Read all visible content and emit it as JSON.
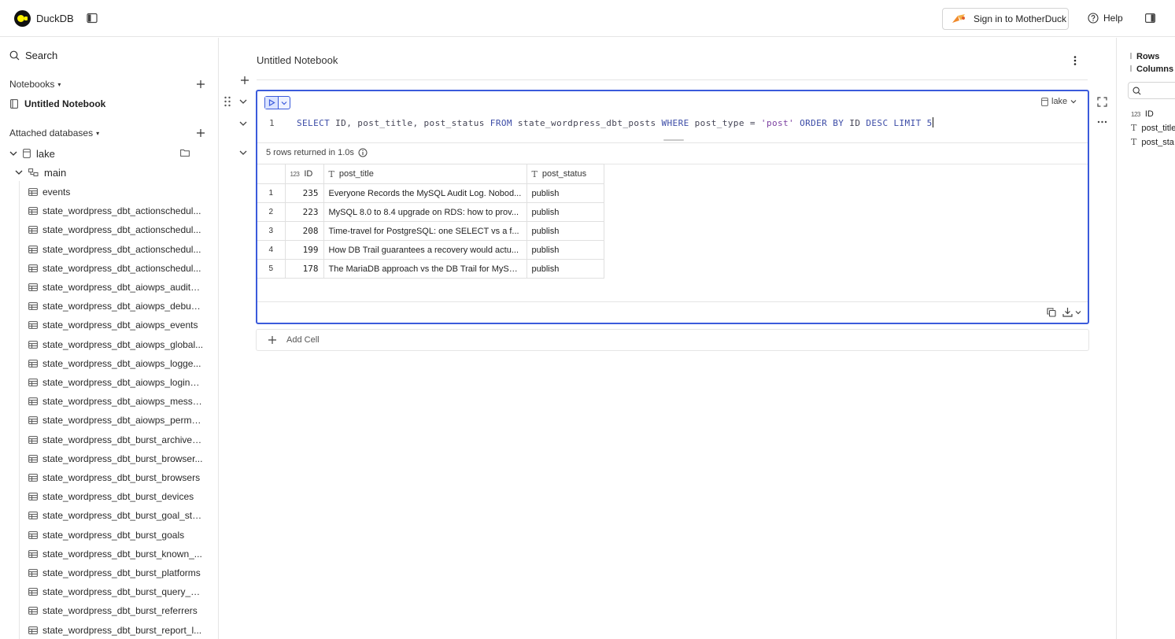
{
  "app": {
    "title": "DuckDB"
  },
  "header": {
    "signin_label": "Sign in to MotherDuck",
    "help_label": "Help"
  },
  "sidebar": {
    "search_label": "Search",
    "notebooks_label": "Notebooks",
    "notebooks": [
      "Untitled Notebook"
    ],
    "attached_label": "Attached databases",
    "database": "lake",
    "schema": "main",
    "tables": [
      "events",
      "state_wordpress_dbt_actionschedul...",
      "state_wordpress_dbt_actionschedul...",
      "state_wordpress_dbt_actionschedul...",
      "state_wordpress_dbt_actionschedul...",
      "state_wordpress_dbt_aiowps_audit_l...",
      "state_wordpress_dbt_aiowps_debug...",
      "state_wordpress_dbt_aiowps_events",
      "state_wordpress_dbt_aiowps_global...",
      "state_wordpress_dbt_aiowps_logge...",
      "state_wordpress_dbt_aiowps_login_l...",
      "state_wordpress_dbt_aiowps_messa...",
      "state_wordpress_dbt_aiowps_perma...",
      "state_wordpress_dbt_burst_archived...",
      "state_wordpress_dbt_burst_browser...",
      "state_wordpress_dbt_burst_browsers",
      "state_wordpress_dbt_burst_devices",
      "state_wordpress_dbt_burst_goal_sta...",
      "state_wordpress_dbt_burst_goals",
      "state_wordpress_dbt_burst_known_...",
      "state_wordpress_dbt_burst_platforms",
      "state_wordpress_dbt_burst_query_st...",
      "state_wordpress_dbt_burst_referrers",
      "state_wordpress_dbt_burst_report_l..."
    ]
  },
  "notebook": {
    "title": "Untitled Notebook",
    "cell": {
      "database": "lake",
      "line_number": "1",
      "query": {
        "t1": "SELECT",
        "t2": " ID, post_title, post_status ",
        "t3": "FROM",
        "t4": " state_wordpress_dbt_posts ",
        "t5": "WHERE",
        "t6": " post_type = ",
        "t7": "'post'",
        "t8": " ",
        "t9": "ORDER BY",
        "t10": " ID ",
        "t11": "DESC",
        "t12": " ",
        "t13": "LIMIT",
        "t14": " 5"
      },
      "result_info": "5 rows returned in 1.0s",
      "columns": [
        {
          "name": "ID",
          "type": "123"
        },
        {
          "name": "post_title",
          "type": "T"
        },
        {
          "name": "post_status",
          "type": "T"
        }
      ],
      "rows": [
        {
          "n": "1",
          "id": "235",
          "title": "Everyone Records the MySQL Audit Log. Nobod...",
          "status": "publish"
        },
        {
          "n": "2",
          "id": "223",
          "title": "MySQL 8.0 to 8.4 upgrade on RDS: how to prov...",
          "status": "publish"
        },
        {
          "n": "3",
          "id": "208",
          "title": "Time-travel for PostgreSQL: one SELECT vs a f...",
          "status": "publish"
        },
        {
          "n": "4",
          "id": "199",
          "title": "How DB Trail guarantees a recovery would actu...",
          "status": "publish"
        },
        {
          "n": "5",
          "id": "178",
          "title": "The MariaDB approach vs the DB Trail for MySQ...",
          "status": "publish"
        }
      ]
    },
    "add_cell_label": "Add Cell"
  },
  "right_panel": {
    "tabs": [
      "Rows",
      "Columns"
    ],
    "columns": [
      {
        "name": "ID",
        "type": "123"
      },
      {
        "name": "post_title",
        "type": "T"
      },
      {
        "name": "post_sta",
        "type": "T"
      }
    ]
  },
  "colors": {
    "accent": "#3b5bdb",
    "logo_yellow": "#fff200"
  }
}
